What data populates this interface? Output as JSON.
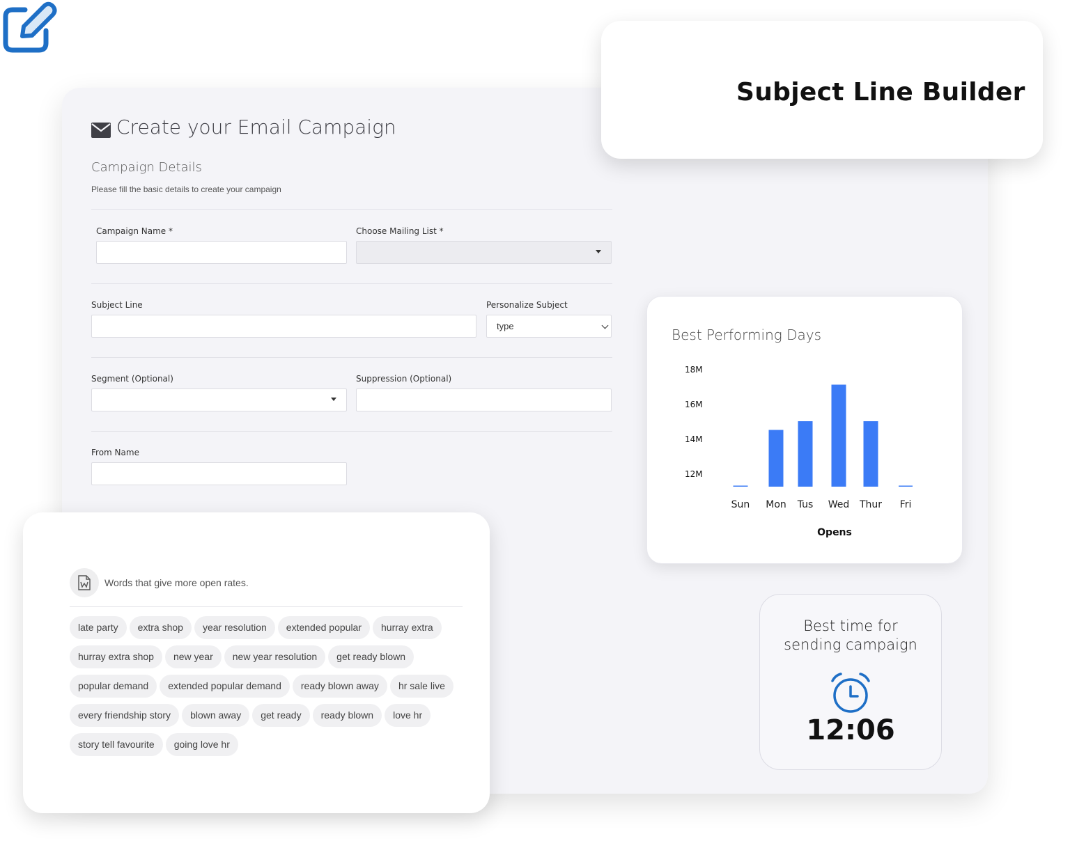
{
  "form": {
    "title": "Create your Email Campaign",
    "section_title": "Campaign Details",
    "section_desc": "Please fill the basic details to create your campaign",
    "campaign_name_label": "Campaign Name *",
    "campaign_name_value": "",
    "mailing_list_label": "Choose Mailing List *",
    "mailing_list_value": "",
    "subject_line_label": "Subject Line",
    "subject_line_value": "",
    "personalize_label": "Personalize Subject",
    "personalize_value": "type",
    "segment_label": "Segment (Optional)",
    "segment_value": "",
    "suppression_label": "Suppression (Optional)",
    "suppression_value": "",
    "from_name_label": "From Name",
    "from_name_value": ""
  },
  "subject_line_builder": {
    "title": "Subject Line Builder",
    "icon": "edit-icon",
    "icon_color": "#1e6fc6"
  },
  "words": {
    "label": "Words that give more open rates.",
    "icon": "word-document-icon",
    "chips": [
      "late party",
      "extra shop",
      "year resolution",
      "extended popular",
      "hurray extra",
      "hurray extra shop",
      "new year",
      "new year resolution",
      "get ready blown",
      "popular demand",
      "extended popular demand",
      "ready blown away",
      "hr sale live",
      "every friendship story",
      "blown away",
      "get ready",
      "ready blown",
      "love hr",
      "story tell favourite",
      "going love hr"
    ]
  },
  "best_time": {
    "title_line1": "Best time for",
    "title_line2": "sending campaign",
    "time": "12:06",
    "icon": "alarm-clock-icon",
    "icon_color": "#1e6fc6"
  },
  "chart_data": {
    "type": "bar",
    "title": "Best Performing Days",
    "xlabel": "Opens",
    "ylabel": "",
    "categories": [
      "Sun",
      "Mon",
      "Tus",
      "Wed",
      "Thur",
      "Fri"
    ],
    "values": [
      11.3,
      14.5,
      15.0,
      17.1,
      15.0,
      11.3
    ],
    "yticks": [
      "18M",
      "16M",
      "14M",
      "12M"
    ],
    "ytick_values": [
      18,
      16,
      14,
      12
    ],
    "ylim": [
      10,
      18
    ],
    "bar_color": "#3b7bf6",
    "grid": false
  }
}
